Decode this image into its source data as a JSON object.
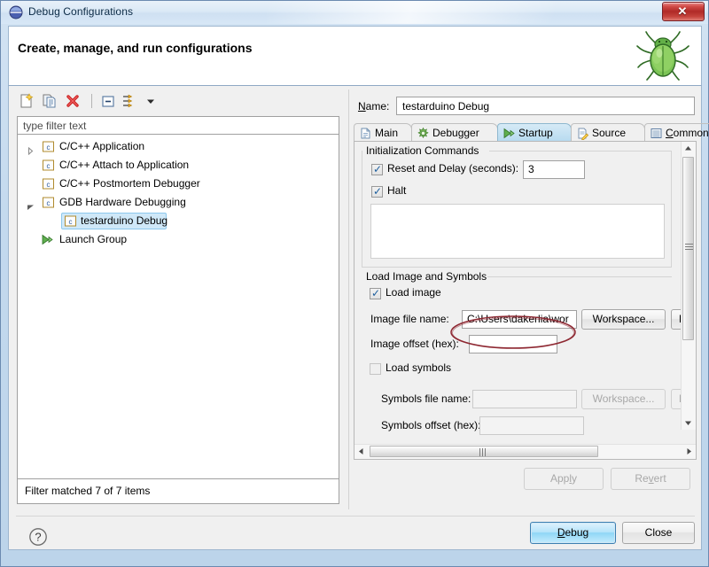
{
  "window": {
    "title": "Debug Configurations",
    "icon": "eclipse-debug-icon",
    "close_label": "✕"
  },
  "header": {
    "title": "Create, manage, and run configurations",
    "icon": "green-bug-icon"
  },
  "toolbar": {
    "items": [
      {
        "name": "new-launch-configuration-icon",
        "label": "New"
      },
      {
        "name": "duplicate-launch-configuration-icon",
        "label": "Duplicate"
      },
      {
        "name": "delete-launch-configuration-icon",
        "label": "Delete"
      },
      {
        "name": "collapse-all-icon",
        "label": "Collapse All"
      },
      {
        "name": "filter-launch-configurations-icon",
        "label": "Filter"
      },
      {
        "name": "view-menu-chevron-down-icon",
        "label": "View Menu"
      }
    ]
  },
  "filter": {
    "placeholder": "type filter text",
    "value": "type filter text"
  },
  "tree": {
    "items": [
      {
        "label": "C/C++ Application",
        "icon": "c-config-icon",
        "indent": 0,
        "twisty": "collapsed",
        "selected": false
      },
      {
        "label": "C/C++ Attach to Application",
        "icon": "c-config-icon",
        "indent": 0,
        "twisty": "none",
        "selected": false
      },
      {
        "label": "C/C++ Postmortem Debugger",
        "icon": "c-config-icon",
        "indent": 0,
        "twisty": "none",
        "selected": false
      },
      {
        "label": "GDB Hardware Debugging",
        "icon": "c-config-icon",
        "indent": 0,
        "twisty": "expanded",
        "selected": false
      },
      {
        "label": "testarduino Debug",
        "icon": "c-config-icon",
        "indent": 1,
        "twisty": "none",
        "selected": true
      },
      {
        "label": "Launch Group",
        "icon": "launch-group-icon",
        "indent": 0,
        "twisty": "none",
        "selected": false
      }
    ]
  },
  "status": {
    "text": "Filter matched 7 of 7 items"
  },
  "config": {
    "name_label": "Name:",
    "name_mnemonic": "N",
    "name_value": "testarduino Debug"
  },
  "tabs": [
    {
      "label": "Main",
      "icon": "document-icon",
      "selected": false
    },
    {
      "label": "Debugger",
      "icon": "debugger-gear-icon",
      "selected": false
    },
    {
      "label": "Startup",
      "icon": "startup-play-icon",
      "selected": true
    },
    {
      "label": "Source",
      "icon": "source-lookup-icon",
      "selected": false
    },
    {
      "label": "Common",
      "icon": "common-icon",
      "selected": false
    }
  ],
  "startup_tab": {
    "init_group": {
      "title": "Initialization Commands",
      "reset_and_delay": {
        "label": "Reset and Delay (seconds):",
        "checked": true,
        "value": "3"
      },
      "halt": {
        "label": "Halt",
        "checked": true
      },
      "commands_text": ""
    },
    "load_group": {
      "title": "Load Image and Symbols",
      "load_image": {
        "label": "Load image",
        "checked": true
      },
      "image_file_name": {
        "label": "Image file name:",
        "value": "C:\\Users\\dakerlia\\wor"
      },
      "image_workspace_button": "Workspace...",
      "image_file_system_button": "F",
      "image_offset": {
        "label": "Image offset (hex):",
        "value": ""
      },
      "load_symbols": {
        "label": "Load symbols",
        "checked": false
      },
      "symbols_file_name": {
        "label": "Symbols file name:",
        "value": ""
      },
      "symbols_workspace_button": "Workspace...",
      "symbols_file_system_button": "F",
      "symbols_offset": {
        "label": "Symbols offset (hex):",
        "value": ""
      }
    }
  },
  "buttons": {
    "apply": {
      "label": "Apply",
      "enabled": false,
      "mnemonic": "l"
    },
    "revert": {
      "label": "Revert",
      "enabled": false,
      "mnemonic": "v"
    },
    "debug": {
      "label": "Debug",
      "enabled": true,
      "default": true,
      "mnemonic": "D"
    },
    "close": {
      "label": "Close",
      "enabled": true,
      "default": false
    }
  },
  "help": {
    "icon": "help-question-icon"
  },
  "annotation": {
    "type": "hand-drawn-ellipse",
    "color": "#8e2832",
    "target": "image-file-name-field"
  }
}
